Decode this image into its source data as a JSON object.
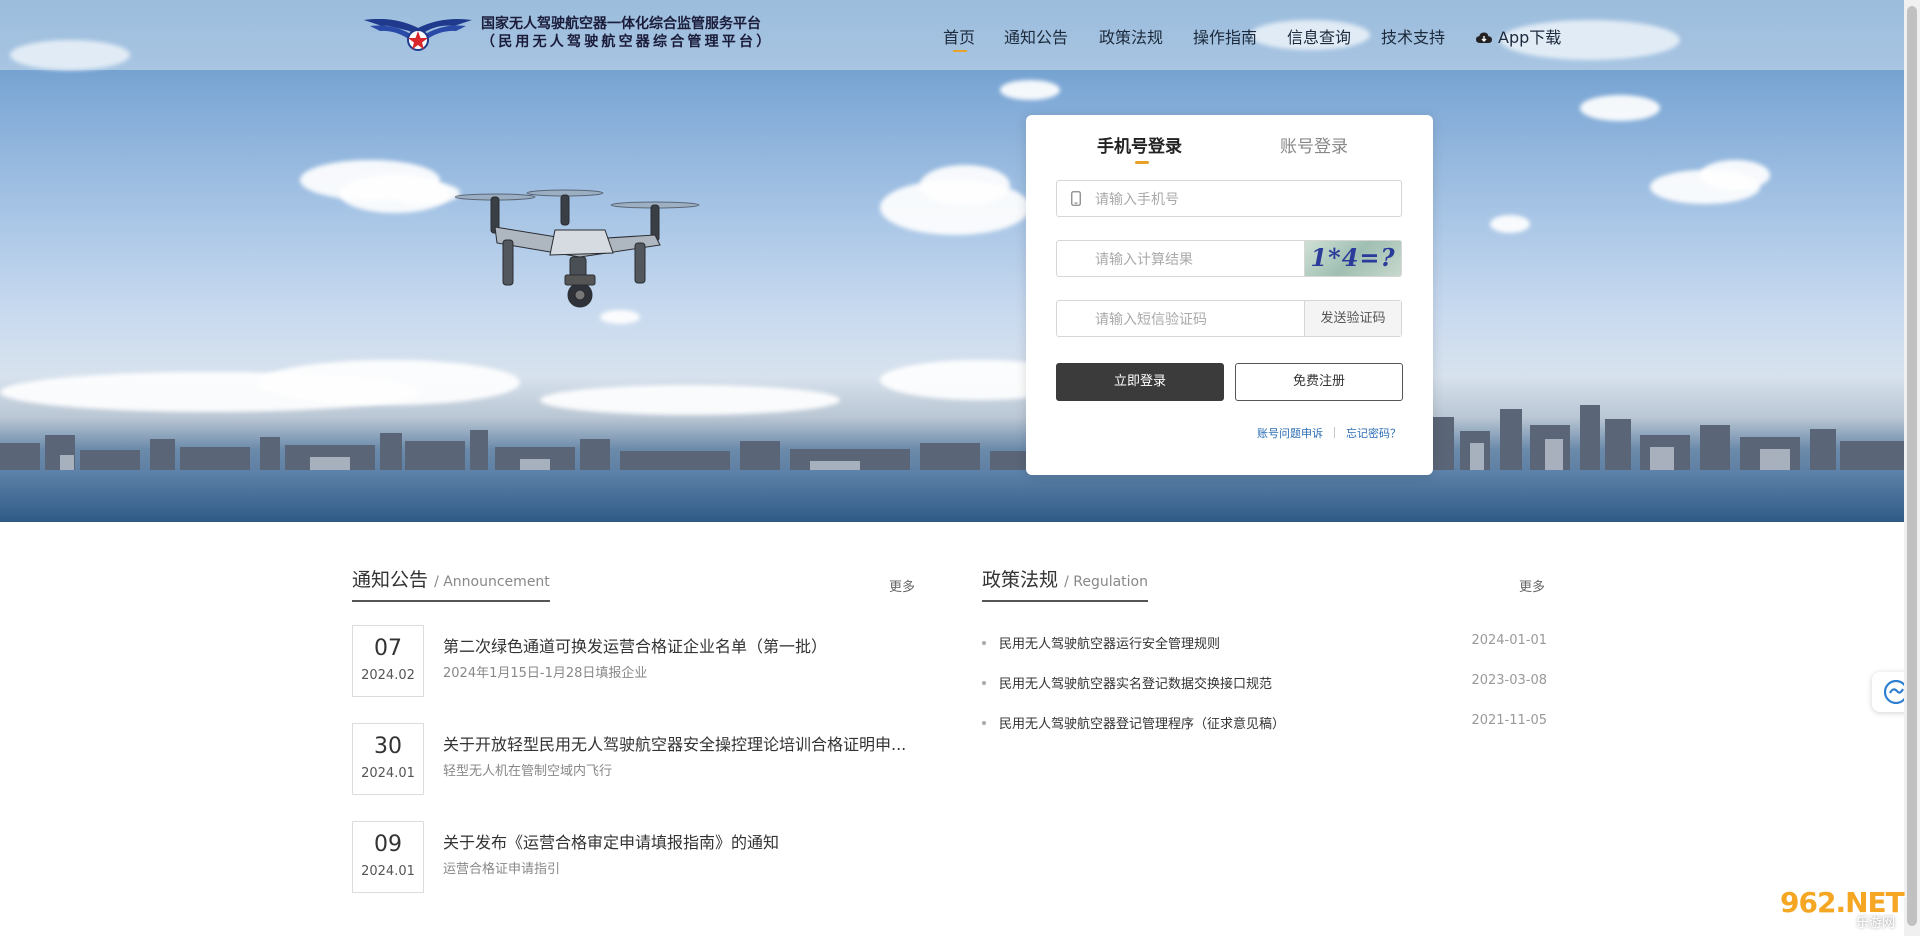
{
  "header": {
    "brand_line1": "国家无人驾驶航空器一体化综合监管服务平台",
    "brand_line2": "（民用无人驾驶航空器综合管理平台）",
    "nav": [
      "首页",
      "通知公告",
      "政策法规",
      "操作指南",
      "信息查询",
      "技术支持",
      "App下载"
    ],
    "active_nav": "首页",
    "accent_color": "#e8a12a"
  },
  "login": {
    "tabs": [
      "手机号登录",
      "账号登录"
    ],
    "active_tab": "手机号登录",
    "phone_placeholder": "请输入手机号",
    "calc_placeholder": "请输入计算结果",
    "captcha_text": "1*4=?",
    "sms_placeholder": "请输入短信验证码",
    "send_code": "发送验证码",
    "login_button": "立即登录",
    "register_button": "免费注册",
    "appeal_link": "账号问题申诉",
    "forgot_link": "忘记密码？"
  },
  "announcements": {
    "title": "通知公告",
    "title_en": "/ Announcement",
    "more": "更多",
    "items": [
      {
        "day": "07",
        "ym": "2024.02",
        "title": "第二次绿色通道可换发运营合格证企业名单（第一批）",
        "subtitle": "2024年1月15日-1月28日填报企业"
      },
      {
        "day": "30",
        "ym": "2024.01",
        "title": "关于开放轻型民用无人驾驶航空器安全操控理论培训合格证明申...",
        "subtitle": "轻型无人机在管制空域内飞行"
      },
      {
        "day": "09",
        "ym": "2024.01",
        "title": "关于发布《运营合格审定申请填报指南》的通知",
        "subtitle": "运营合格证申请指引"
      }
    ]
  },
  "regulations": {
    "title": "政策法规",
    "title_en": "/ Regulation",
    "more": "更多",
    "items": [
      {
        "title": "民用无人驾驶航空器运行安全管理规则",
        "date": "2024-01-01"
      },
      {
        "title": "民用无人驾驶航空器实名登记数据交换接口规范",
        "date": "2023-03-08"
      },
      {
        "title": "民用无人驾驶航空器登记管理程序（征求意见稿）",
        "date": "2021-11-05"
      }
    ]
  },
  "watermark": {
    "big": "962.NET",
    "small": "乐游网"
  }
}
